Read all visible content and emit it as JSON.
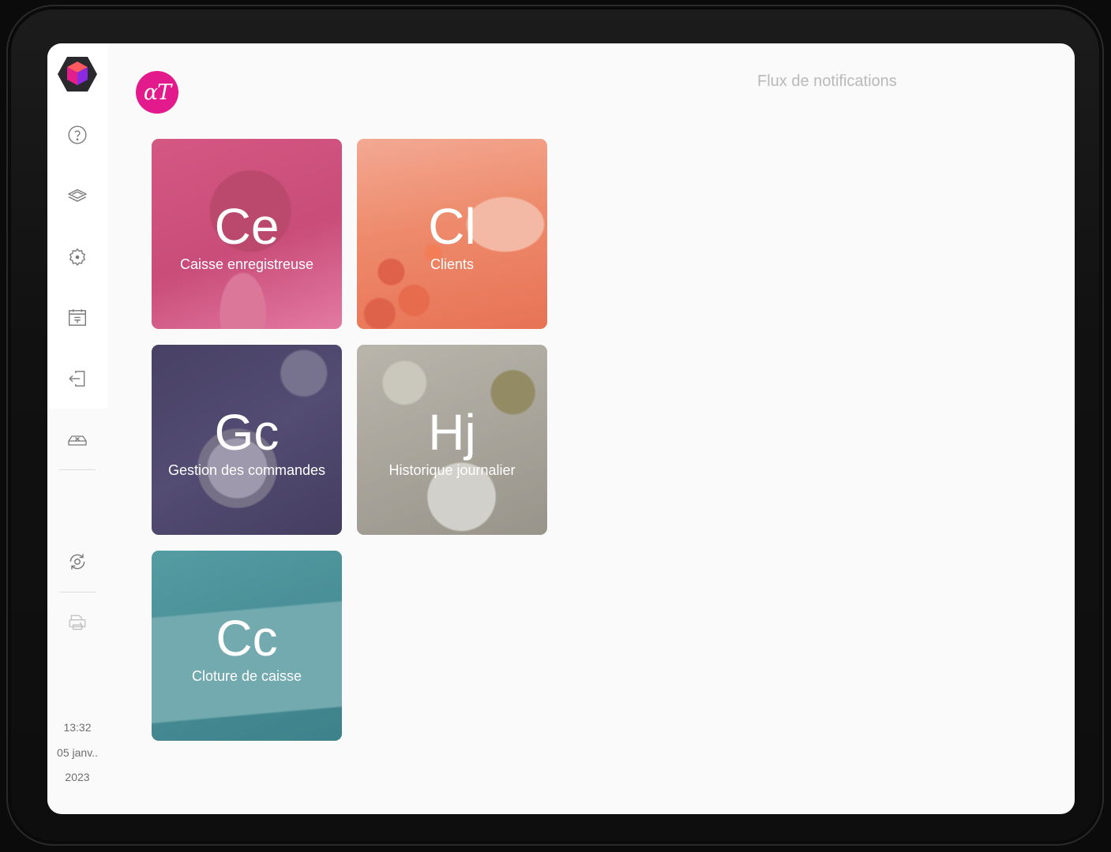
{
  "header": {
    "avatar_initials": "αT",
    "notifications_title": "Flux de notifications"
  },
  "sidebar": {
    "items": [
      {
        "name": "help-icon"
      },
      {
        "name": "layers-icon"
      },
      {
        "name": "gear-icon"
      },
      {
        "name": "calendar-icon"
      },
      {
        "name": "logout-icon"
      },
      {
        "name": "cash-drawer-icon"
      },
      {
        "name": "sync-icon"
      },
      {
        "name": "printer-icon"
      }
    ],
    "time": "13:32",
    "date": "05 janv..",
    "year": "2023"
  },
  "tiles": [
    {
      "abbr": "Ce",
      "label": "Caisse enregistreuse"
    },
    {
      "abbr": "Cl",
      "label": "Clients"
    },
    {
      "abbr": "Gc",
      "label": "Gestion des commandes"
    },
    {
      "abbr": "Hj",
      "label": "Historique journalier"
    },
    {
      "abbr": "Cc",
      "label": "Cloture de caisse"
    }
  ],
  "colors": {
    "accent": "#e31a8c",
    "screen_bg": "#fafafa",
    "sidebar_bg": "#ffffff"
  }
}
